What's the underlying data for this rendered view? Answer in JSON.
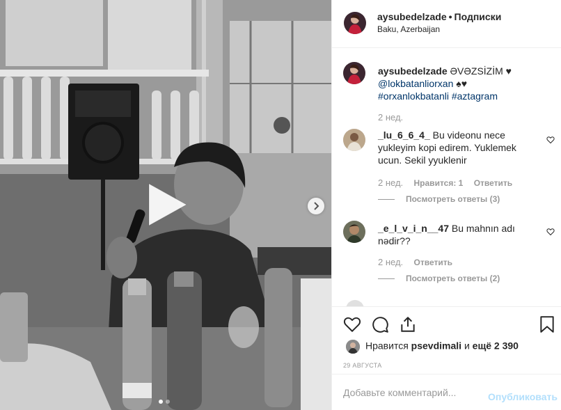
{
  "post": {
    "author": "aysubedelzade",
    "separator": "•",
    "follow_label": "Подписки",
    "location": "Baku, Azerbaijan"
  },
  "caption": {
    "username": "aysubedelzade",
    "text": "ƏVƏZSİZİM ♥",
    "mention": "@lokbatanliorxan",
    "emoji": "♠♥",
    "hashtag1": "#orxanlokbatanli",
    "hashtag2": "#aztagram",
    "time": "2 нед."
  },
  "comments": [
    {
      "username": "_lu_6_6_4_",
      "text": "Bu videonu nece yukleyim kopi edirem. Yuklemek ucun. Sekil yyuklenir",
      "time": "2 нед.",
      "likes": "Нравится: 1",
      "reply_label": "Ответить",
      "view_replies": "Посмотреть ответы (3)"
    },
    {
      "username": "_e_l_v_i_n__47",
      "text": "Bu mahnın adı nədir??",
      "time": "2 нед.",
      "reply_label": "Ответить",
      "view_replies": "Посмотреть ответы (2)"
    }
  ],
  "likes": {
    "prefix": "Нравится",
    "user": "psevdimali",
    "conj": "и",
    "more": "ещё 2 390"
  },
  "date": "29 АВГУСТА",
  "add_comment": {
    "placeholder": "Добавьте комментарий...",
    "publish_label": "Опубликовать"
  },
  "icons": {
    "like": "heart-icon",
    "comment": "comment-icon",
    "share": "share-icon",
    "save": "bookmark-icon",
    "play": "play-icon",
    "next": "chevron-right-icon"
  },
  "colors": {
    "link": "#003569",
    "muted": "#999999",
    "publish_disabled": "#b2dffc",
    "border": "#efefef"
  },
  "media": {
    "is_video": true,
    "slide_count": 2,
    "current_slide": 1
  }
}
